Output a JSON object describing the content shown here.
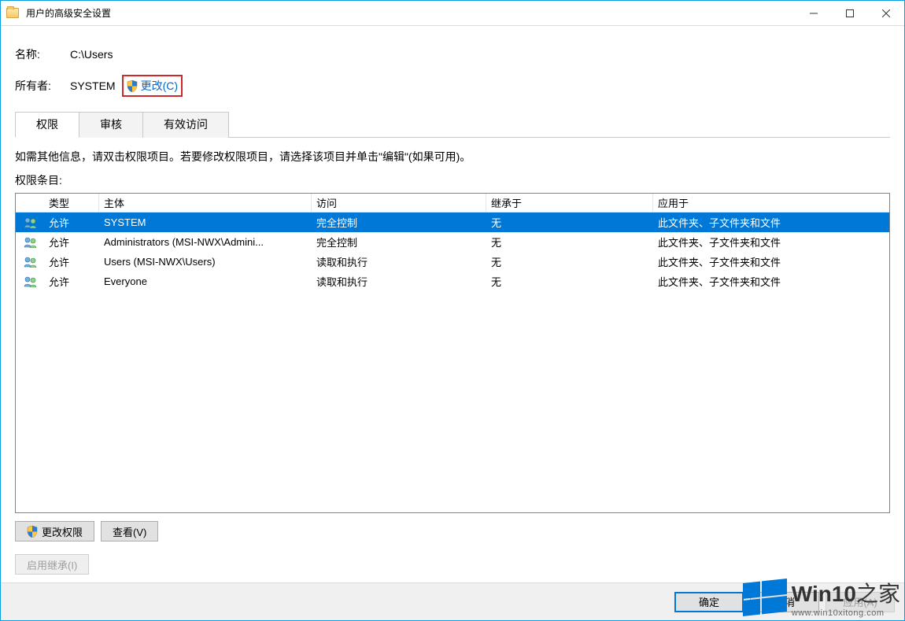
{
  "window": {
    "title": "用户的高级安全设置"
  },
  "info": {
    "name_label": "名称:",
    "name_value": "C:\\Users",
    "owner_label": "所有者:",
    "owner_value": "SYSTEM",
    "change_link": "更改(C)"
  },
  "tabs": {
    "permissions": "权限",
    "auditing": "审核",
    "effective": "有效访问"
  },
  "instruction": "如需其他信息，请双击权限项目。若要修改权限项目，请选择该项目并单击\"编辑\"(如果可用)。",
  "entries_label": "权限条目:",
  "columns": {
    "type": "类型",
    "principal": "主体",
    "access": "访问",
    "inherited": "继承于",
    "applies": "应用于"
  },
  "rows": [
    {
      "type": "允许",
      "principal": "SYSTEM",
      "access": "完全控制",
      "inherited": "无",
      "applies": "此文件夹、子文件夹和文件",
      "selected": true
    },
    {
      "type": "允许",
      "principal": "Administrators (MSI-NWX\\Admini...",
      "access": "完全控制",
      "inherited": "无",
      "applies": "此文件夹、子文件夹和文件",
      "selected": false
    },
    {
      "type": "允许",
      "principal": "Users (MSI-NWX\\Users)",
      "access": "读取和执行",
      "inherited": "无",
      "applies": "此文件夹、子文件夹和文件",
      "selected": false
    },
    {
      "type": "允许",
      "principal": "Everyone",
      "access": "读取和执行",
      "inherited": "无",
      "applies": "此文件夹、子文件夹和文件",
      "selected": false
    }
  ],
  "buttons": {
    "change_perm": "更改权限",
    "view": "查看(V)",
    "enable_inherit": "启用继承(I)",
    "ok": "确定",
    "cancel": "取消",
    "apply": "应用(A)"
  },
  "watermark": {
    "brand_a": "Win10",
    "brand_b": "之家",
    "url": "www.win10xitong.com"
  }
}
